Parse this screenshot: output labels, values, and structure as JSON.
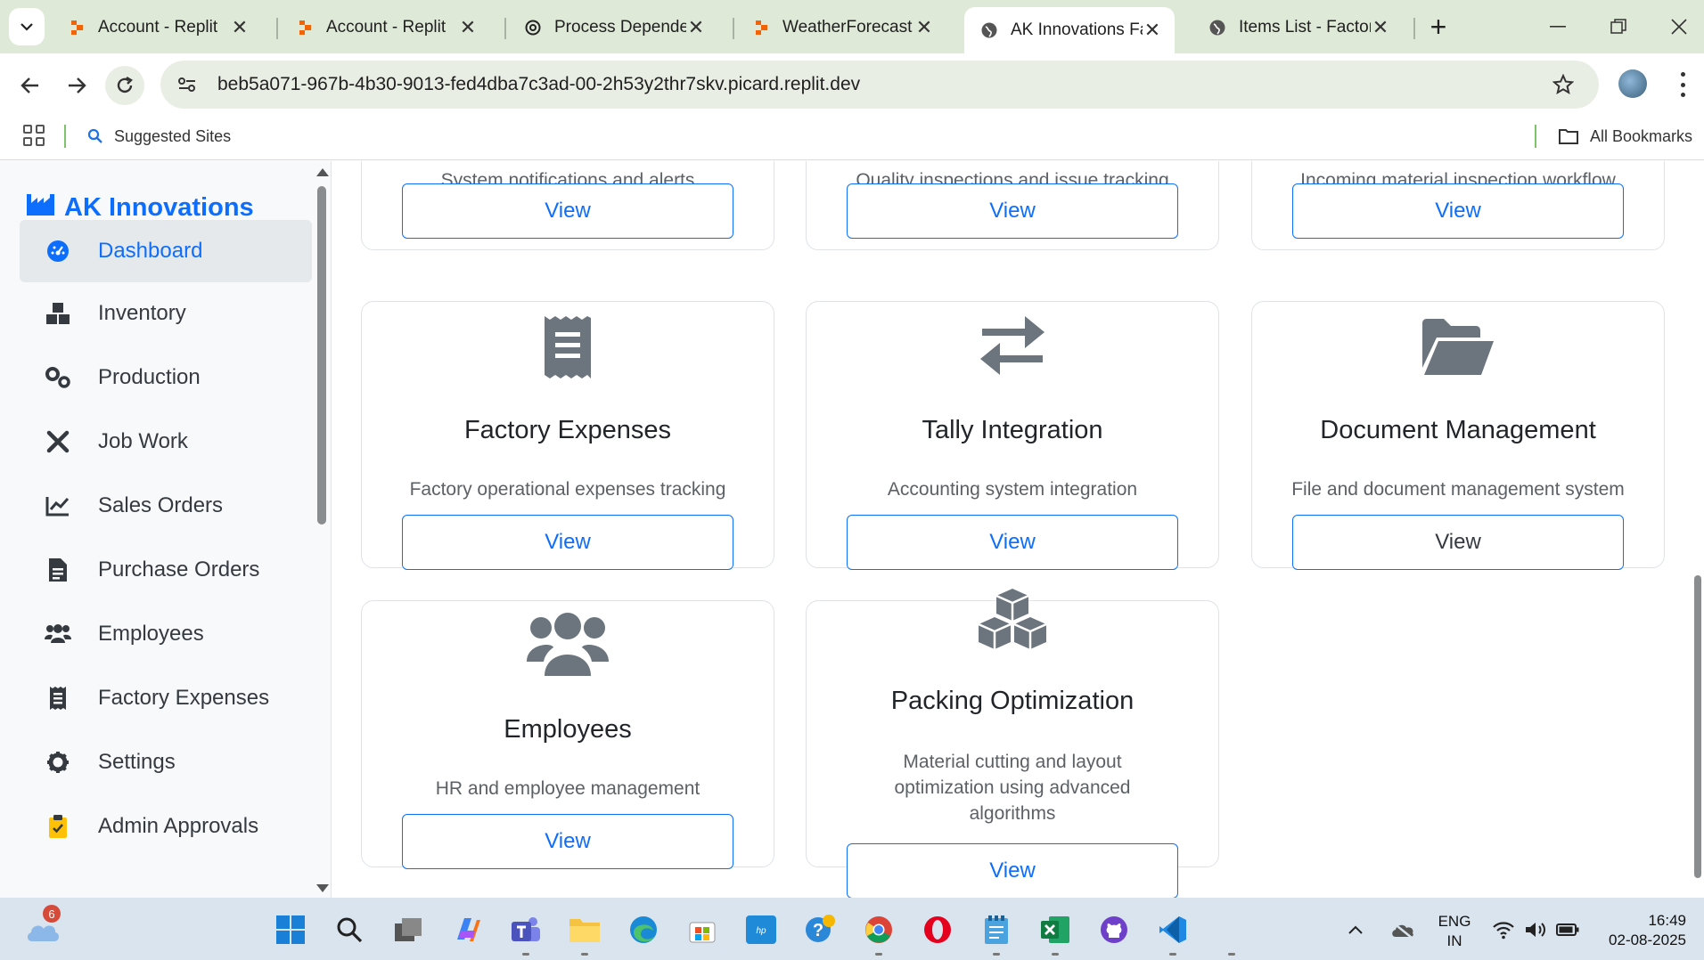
{
  "browser": {
    "tabs": [
      {
        "title": "Account - Replit",
        "favicon": "replit-icon"
      },
      {
        "title": "Account - Replit",
        "favicon": "replit-icon"
      },
      {
        "title": "Process Dependen",
        "favicon": "openai-icon"
      },
      {
        "title": "WeatherForecast -",
        "favicon": "replit-icon"
      },
      {
        "title": "AK Innovations Fac",
        "favicon": "globe-icon",
        "active": true
      },
      {
        "title": "Items List - Factory",
        "favicon": "globe-icon"
      }
    ],
    "url": "beb5a071-967b-4b30-9013-fed4dba7c3ad-00-2h53y2thr7skv.picard.replit.dev",
    "bookmarks": {
      "suggested_sites": "Suggested Sites",
      "all_bookmarks": "All Bookmarks"
    }
  },
  "sidebar": {
    "brand": "AK Innovations",
    "items": [
      {
        "label": "Dashboard",
        "icon": "dashboard-icon",
        "active": true
      },
      {
        "label": "Inventory",
        "icon": "boxes-icon"
      },
      {
        "label": "Production",
        "icon": "cogs-icon"
      },
      {
        "label": "Job Work",
        "icon": "tools-icon"
      },
      {
        "label": "Sales Orders",
        "icon": "line-chart-icon"
      },
      {
        "label": "Purchase Orders",
        "icon": "invoice-icon"
      },
      {
        "label": "Employees",
        "icon": "users-icon"
      },
      {
        "label": "Factory Expenses",
        "icon": "receipt-icon"
      },
      {
        "label": "Settings",
        "icon": "gear-icon"
      },
      {
        "label": "Admin Approvals",
        "icon": "clipboard-icon"
      }
    ]
  },
  "cards": {
    "top": [
      {
        "desc": "System notifications and alerts",
        "button": "View"
      },
      {
        "desc": "Quality inspections and issue tracking",
        "button": "View"
      },
      {
        "desc": "Incoming material inspection workflow",
        "button": "View"
      }
    ],
    "factory_expenses": {
      "title": "Factory Expenses",
      "desc": "Factory operational expenses tracking",
      "button": "View",
      "icon": "receipt-icon"
    },
    "tally": {
      "title": "Tally Integration",
      "desc": "Accounting system integration",
      "button": "View",
      "icon": "exchange-arrows-icon"
    },
    "documents": {
      "title": "Document Management",
      "desc": "File and document management system",
      "button": "View",
      "icon": "folder-open-icon"
    },
    "employees": {
      "title": "Employees",
      "desc": "HR and employee management",
      "button": "View",
      "icon": "users-icon"
    },
    "packing": {
      "title": "Packing Optimization",
      "desc_line1": "Material cutting and layout",
      "desc_line2": "optimization using advanced",
      "desc_line3": "algorithms",
      "button": "View",
      "icon": "cubes-icon"
    }
  },
  "taskbar": {
    "weather_badge": "6",
    "language_line1": "ENG",
    "language_line2": "IN",
    "time": "16:49",
    "date": "02-08-2025"
  },
  "colors": {
    "accent": "#0d6efd",
    "tabstrip": "#dfe9d8",
    "taskbar": "#d9e4ee"
  }
}
